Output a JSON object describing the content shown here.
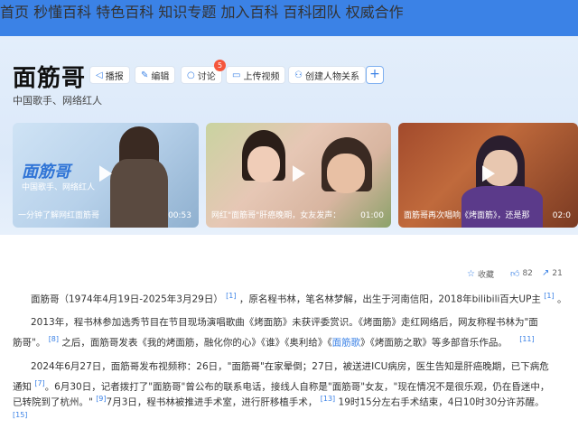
{
  "nav": {
    "items": [
      "首页",
      "秒懂百科",
      "特色百科",
      "知识专题",
      "加入百科",
      "百科团队",
      "权威合作"
    ]
  },
  "entry": {
    "title": "面筋哥",
    "subtitle": "中国歌手、网络红人"
  },
  "toolbar": {
    "broadcast": "播报",
    "edit": "编辑",
    "discuss": "讨论",
    "discuss_badge": "5",
    "upload_video": "上传视频",
    "create_relation": "创建人物关系",
    "add": "+"
  },
  "videos": [
    {
      "caption": "一分钟了解网红面筋哥",
      "duration": "00:53",
      "brand": "面筋哥",
      "brand_sub": "中国歌手、网络红人"
    },
    {
      "caption": "网红\"面筋哥\"肝癌晚期，女友发声：",
      "duration": "01:00"
    },
    {
      "caption": "面筋哥再次唱响《烤面筋》，还是那",
      "duration": "02:0"
    }
  ],
  "stats": {
    "favorite": "收藏",
    "likes": "82",
    "shares": "21"
  },
  "paragraphs": {
    "p1_a": "面筋哥（1974年4月19日-2025年3月29日）",
    "p1_ref1": "[1]",
    "p1_b": "，原名程书林，笔名林梦解，出生于河南信阳，2018年bilibili百大UP主",
    "p1_ref2": "[1]",
    "p1_c": "。",
    "p2_line1": "2013年，程书林参加选秀节目在节目现场演唱歌曲《烤面筋》未获评委赏识。《烤面筋》走红网络后，网友称程书林为\"面",
    "p2_line2_a": "筋哥\"。",
    "p2_ref1": "[8]",
    "p2_line2_b": "之后，面筋哥发表《我的烤面筋，融化你的心》《谁》《奥利给》《",
    "p2_link": "面筋歌",
    "p2_line2_c": "》《烤面筋之歌》等多部音乐作品。",
    "p2_ref2": "[11]",
    "p3_line1": "2024年6月27日，面筋哥发布视频称：26日，\"面筋哥\"在家晕倒；27日，被送进ICU病房，医生告知是肝癌晚期，已下病危",
    "p3_line2_a": "通知",
    "p3_ref1": "[7]",
    "p3_line2_b": "。6月30日，记者拨打了\"面筋哥\"曾公布的联系电话，接线人自称是\"面筋哥\"女友，\"现在情况不是很乐观，仍在昏迷中，",
    "p3_line3_a": "已转院到了杭州。\"",
    "p3_ref2": "[9]",
    "p3_line3_b": "7月3日，程书林被推进手术室，进行肝移植手术，",
    "p3_ref3": "[13]",
    "p3_line3_c": "19时15分左右手术结束，4日10时30分许苏醒。",
    "p3_ref4": "[15]"
  }
}
